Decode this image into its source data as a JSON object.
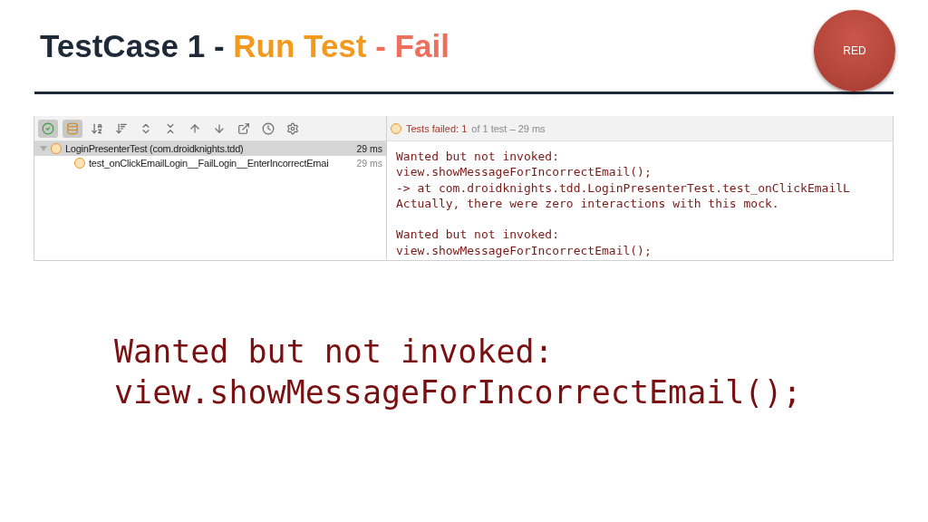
{
  "title": [
    {
      "text": "TestCase 1 - ",
      "color": "#1f2a38"
    },
    {
      "text": "Run Test",
      "color": "#f39a1e"
    },
    {
      "text": " - Fail",
      "color": "#ef6f5e"
    }
  ],
  "badge": {
    "label": "RED"
  },
  "toolbar": [
    {
      "kind": "passed",
      "selected": true
    },
    {
      "kind": "ignored",
      "selected": true
    },
    {
      "kind": "sort-alpha",
      "selected": false
    },
    {
      "kind": "sort-duration",
      "selected": false
    },
    {
      "kind": "expand",
      "selected": false
    },
    {
      "kind": "collapse",
      "selected": false
    },
    {
      "kind": "up",
      "selected": false
    },
    {
      "kind": "down",
      "selected": false
    },
    {
      "kind": "export",
      "selected": false
    },
    {
      "kind": "history",
      "selected": false
    },
    {
      "kind": "settings",
      "selected": false
    }
  ],
  "status": {
    "failed": "Tests failed: 1",
    "summary": "of 1 test – 29 ms"
  },
  "tree": [
    {
      "label": "LoginPresenterTest (com.droidknights.tdd)",
      "time": "29 ms",
      "selected": true,
      "expanded": true,
      "children": [
        {
          "label": "test_onClickEmailLogin__FailLogin__EnterIncorrectEmai",
          "time": "29 ms",
          "selected": false
        }
      ]
    }
  ],
  "output": [
    [
      "Wanted but not invoked:",
      "view.showMessageForIncorrectEmail();",
      "-> at com.droidknights.tdd.LoginPresenterTest.test_onClickEmailL",
      "Actually, there were zero interactions with this mock."
    ],
    [
      "Wanted but not invoked:",
      "view.showMessageForIncorrectEmail();"
    ]
  ],
  "callout": [
    "Wanted but not invoked:",
    "view.showMessageForIncorrectEmail();"
  ]
}
